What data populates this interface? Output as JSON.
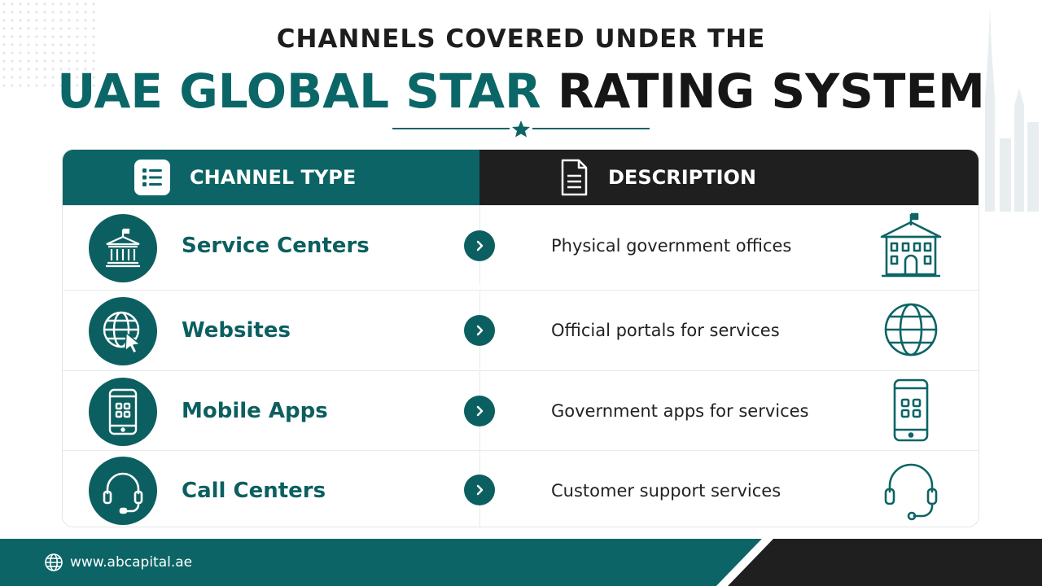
{
  "title": {
    "line1": "CHANNELS COVERED UNDER THE",
    "line2_teal": "UAE GLOBAL STAR",
    "line2_dark": " RATING SYSTEM"
  },
  "table": {
    "header_left": "CHANNEL TYPE",
    "header_right": "DESCRIPTION",
    "rows": [
      {
        "name": "Service Centers",
        "description": "Physical government offices",
        "icon": "government-building-icon"
      },
      {
        "name": "Websites",
        "description": "Official portals for services",
        "icon": "globe-icon"
      },
      {
        "name": "Mobile Apps",
        "description": "Government apps for services",
        "icon": "mobile-phone-icon"
      },
      {
        "name": "Call Centers",
        "description": "Customer support services",
        "icon": "headset-icon"
      }
    ]
  },
  "footer": {
    "url": "www.abcapital.ae"
  },
  "colors": {
    "teal": "#0c6466",
    "dark": "#1f1f1f",
    "accent_text": "#0c5f60"
  }
}
